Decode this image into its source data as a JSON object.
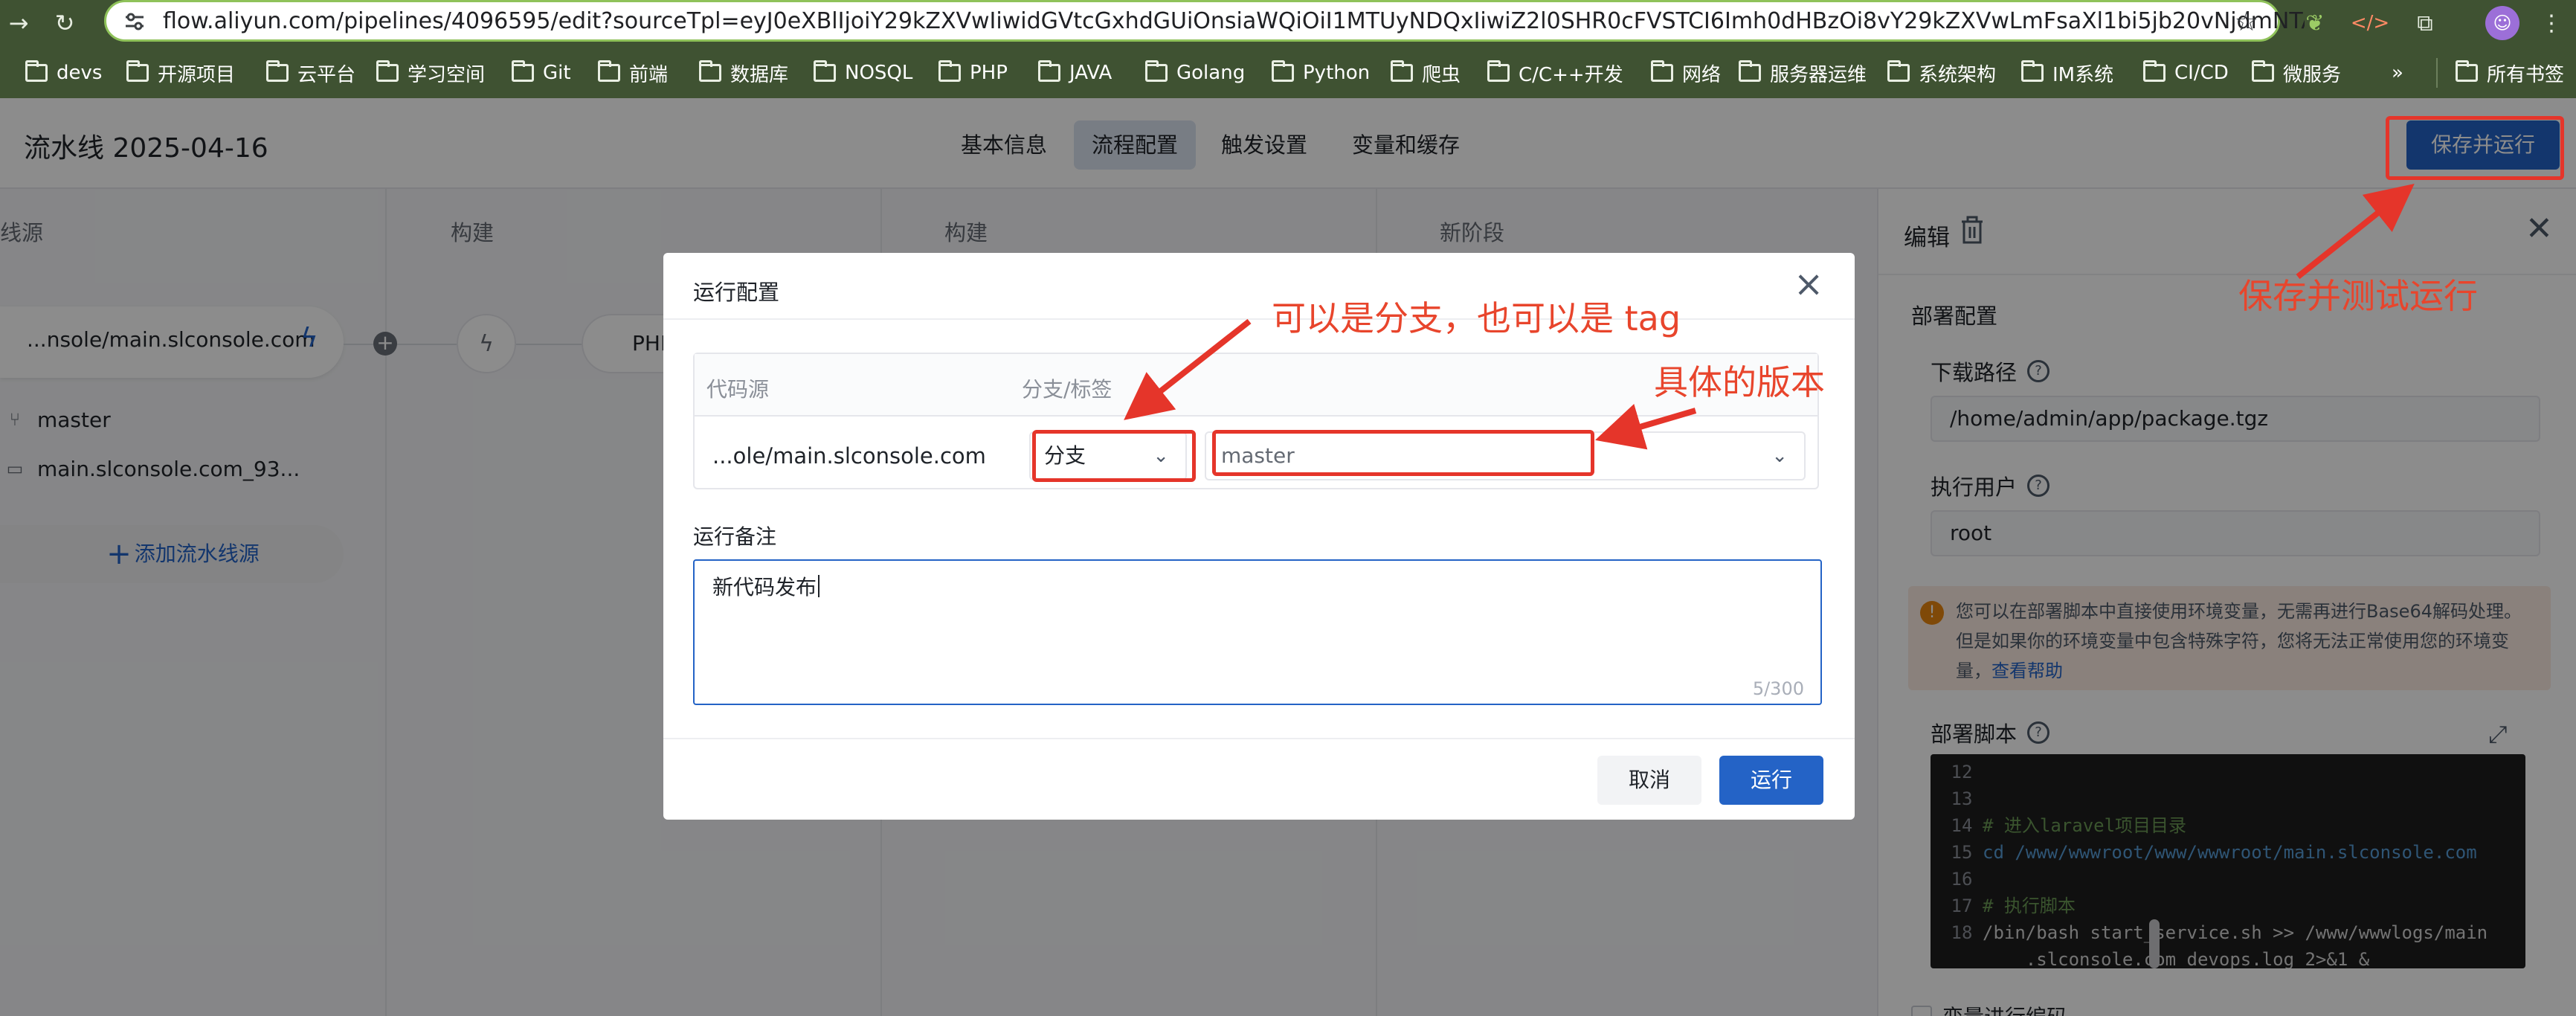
{
  "browser": {
    "url": "flow.aliyun.com/pipelines/4096595/edit?sourceTpl=eyJ0eXBlIjoiY29kZXVwIiwidGVtcGxhdGUiOnsiaWQiOiI1MTUyNDQxIiwiZ2l0SHR0cFVSTCI6Imh0dHBzOi8vY29kZXVwLmFsaXl1bi5jb20vNjdmNTA4YjlyMjg2M...",
    "bookmarks": [
      "devs",
      "开源项目",
      "云平台",
      "学习空间",
      "Git",
      "前端",
      "数据库",
      "NOSQL",
      "PHP",
      "JAVA",
      "Golang",
      "Python",
      "爬虫",
      "C/C++开发",
      "网络",
      "服务器运维",
      "系统架构",
      "IM系统",
      "CI/CD",
      "微服务"
    ],
    "bookmarks_more": "»",
    "all_bookmarks": "所有书签"
  },
  "header": {
    "title": "流水线 2025-04-16",
    "tabs": [
      "基本信息",
      "流程配置",
      "触发设置",
      "变量和缓存"
    ],
    "active_tab": "流程配置",
    "save_run_label": "保存并运行"
  },
  "canvas": {
    "stages": [
      "线源",
      "构建",
      "构建",
      "新阶段"
    ],
    "source_name": "...nsole/main.slconsole.com",
    "source_branch": "master",
    "source_dir": "main.slconsole.com_93...",
    "job_label": "PHI",
    "add_source_label": "添加流水线源"
  },
  "panel": {
    "title": "编辑",
    "section_title": "部署配置",
    "download_path_label": "下载路径",
    "download_path_value": "/home/admin/app/package.tgz",
    "exec_user_label": "执行用户",
    "exec_user_value": "root",
    "warning_text": "您可以在部署脚本中直接使用环境变量，无需再进行Base64解码处理。但是如果你的环境变量中包含特殊字符，您将无法正常使用您的环境变量，",
    "warning_link": "查看帮助",
    "script_label": "部署脚本",
    "code_lines": [
      {
        "n": "12",
        "text": ""
      },
      {
        "n": "13",
        "text": ""
      },
      {
        "n": "14",
        "text": "# 进入laravel项目目录"
      },
      {
        "n": "15",
        "text": "cd /www/wwwroot/www/wwwroot/main.slconsole.com"
      },
      {
        "n": "16",
        "text": ""
      },
      {
        "n": "17",
        "text": "# 执行脚本"
      },
      {
        "n": "18",
        "text": "/bin/bash start_service.sh >> /www/wwwlogs/main"
      },
      {
        "n": "",
        "text": "    .slconsole.com_devops.log 2>&1 &"
      }
    ],
    "checkbox_label": "变量进行编码"
  },
  "modal": {
    "title": "运行配置",
    "col_source": "代码源",
    "col_branch_tag": "分支/标签",
    "repo": "...ole/main.slconsole.com",
    "type_value": "分支",
    "version_value": "master",
    "remark_label": "运行备注",
    "remark_value": "新代码发布",
    "remark_counter": "5/300",
    "cancel_label": "取消",
    "run_label": "运行"
  },
  "annotations": {
    "branch_or_tag": "可以是分支，也可以是 tag",
    "specific_version": "具体的版本",
    "save_and_test": "保存并测试运行"
  },
  "colors": {
    "primary": "#2463c6",
    "annotation_red": "#e5352a",
    "chrome_green": "#3f5232"
  }
}
